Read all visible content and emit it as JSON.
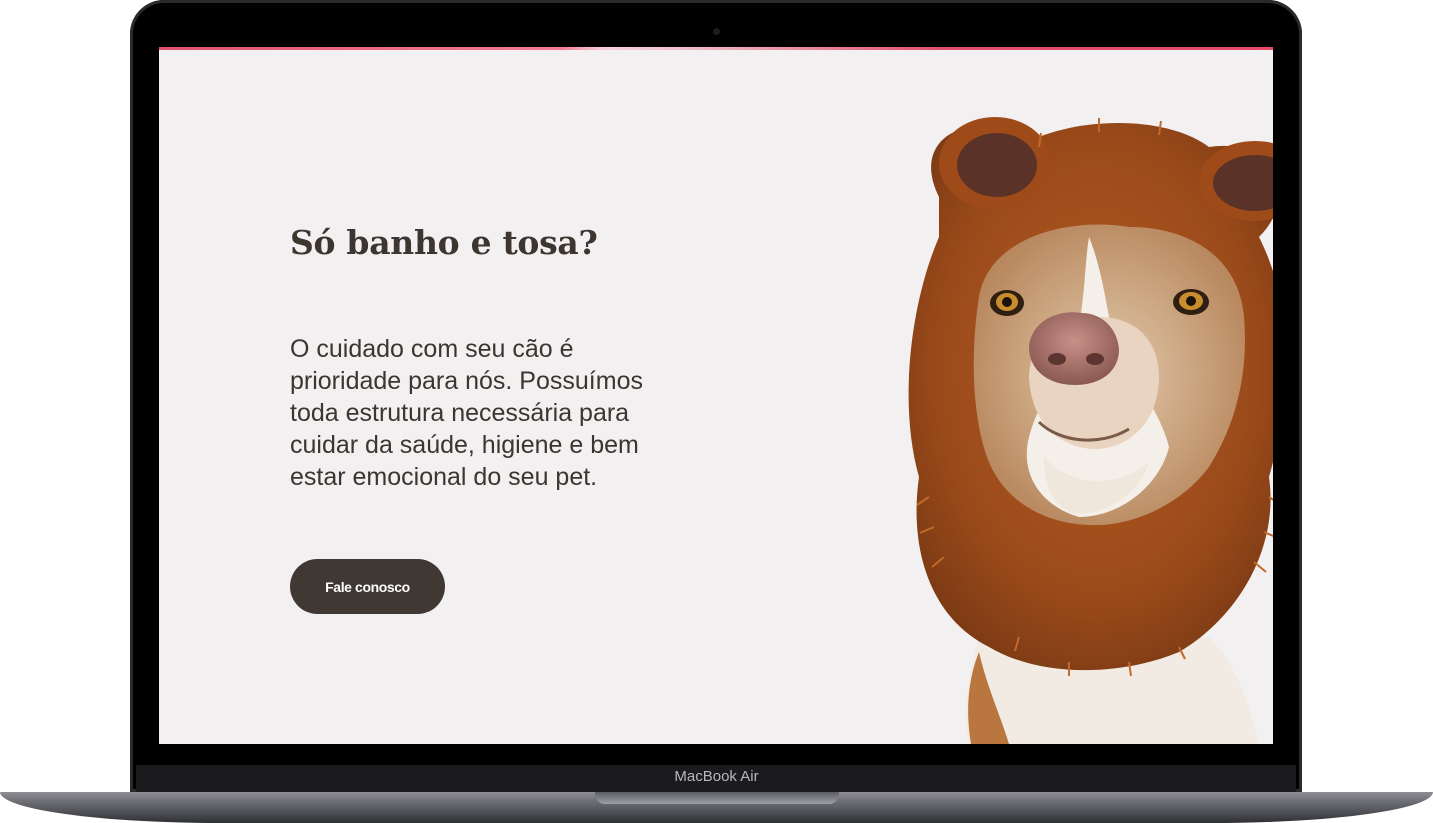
{
  "device": {
    "label": "MacBook Air"
  },
  "hero": {
    "title": "Só banho e tosa?",
    "description": "O cuidado com seu cão é prioridade para nós. Possuímos toda estrutura necessária para cuidar da saúde, higiene e bem estar emocional do seu pet.",
    "cta_label": "Fale conosco",
    "image_icon": "dog-in-bear-hood-photo"
  },
  "colors": {
    "background": "#f3f0f1",
    "accent": "#e2506e",
    "text": "#3c3530",
    "button": "#3f3833",
    "button_text": "#ffffff",
    "fur": "#9a4a1a"
  }
}
